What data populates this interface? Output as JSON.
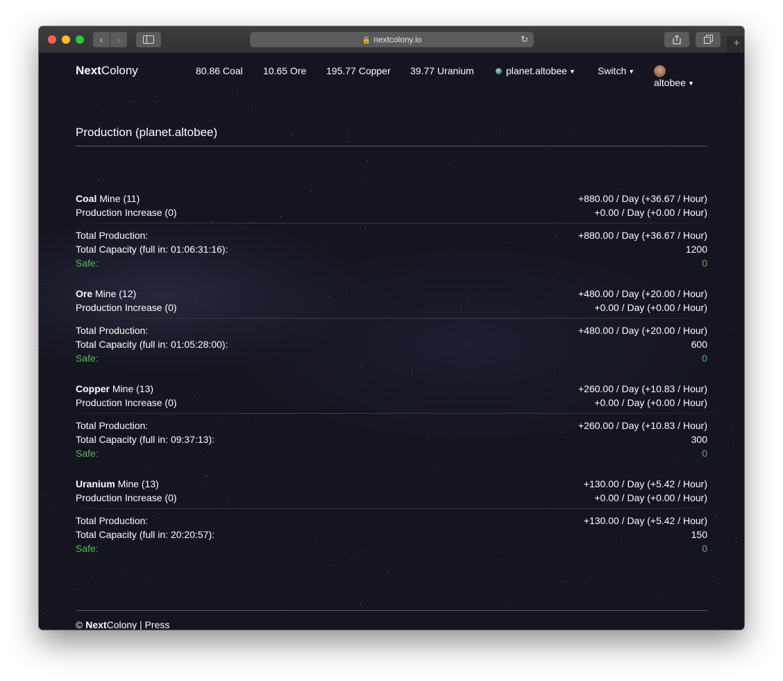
{
  "browser": {
    "url": "nextcolony.io"
  },
  "nav": {
    "brand_bold": "Next",
    "brand_rest": "Colony",
    "resources": [
      "80.86 Coal",
      "10.65 Ore",
      "195.77 Copper",
      "39.77 Uranium"
    ],
    "planet": "planet.altobee",
    "switch_label": "Switch",
    "user": "altobee"
  },
  "page_title": "Production (planet.altobee)",
  "mines": [
    {
      "resource": "Coal",
      "mine_label": " Mine (11)",
      "rate": "+880.00 / Day (+36.67 / Hour)",
      "increase_label": "Production Increase (0)",
      "increase_rate": "+0.00 / Day (+0.00 / Hour)",
      "total_label": "Total Production:",
      "total_rate": "+880.00 / Day (+36.67 / Hour)",
      "capacity_label": "Total Capacity (full in: 01:06:31:16):",
      "capacity": "1200",
      "safe_label": "Safe:",
      "safe": "0"
    },
    {
      "resource": "Ore",
      "mine_label": " Mine (12)",
      "rate": "+480.00 / Day (+20.00 / Hour)",
      "increase_label": "Production Increase (0)",
      "increase_rate": "+0.00 / Day (+0.00 / Hour)",
      "total_label": "Total Production:",
      "total_rate": "+480.00 / Day (+20.00 / Hour)",
      "capacity_label": "Total Capacity (full in: 01:05:28:00):",
      "capacity": "600",
      "safe_label": "Safe:",
      "safe": "0"
    },
    {
      "resource": "Copper",
      "mine_label": " Mine (13)",
      "rate": "+260.00 / Day (+10.83 / Hour)",
      "increase_label": "Production Increase (0)",
      "increase_rate": "+0.00 / Day (+0.00 / Hour)",
      "total_label": "Total Production:",
      "total_rate": "+260.00 / Day (+10.83 / Hour)",
      "capacity_label": "Total Capacity (full in: 09:37:13):",
      "capacity": "300",
      "safe_label": "Safe:",
      "safe": "0"
    },
    {
      "resource": "Uranium",
      "mine_label": " Mine (13)",
      "rate": "+130.00 / Day (+5.42 / Hour)",
      "increase_label": "Production Increase (0)",
      "increase_rate": "+0.00 / Day (+0.00 / Hour)",
      "total_label": "Total Production:",
      "total_rate": "+130.00 / Day (+5.42 / Hour)",
      "capacity_label": "Total Capacity (full in: 20:20:57):",
      "capacity": "150",
      "safe_label": "Safe:",
      "safe": "0"
    }
  ],
  "footer": {
    "copyright": "©",
    "brand_bold": "Next",
    "brand_rest": "Colony",
    "separator": "|",
    "press": "Press"
  },
  "colors": {
    "background": "#14151f",
    "safe_green": "#5cb85c",
    "text": "#ffffff"
  }
}
